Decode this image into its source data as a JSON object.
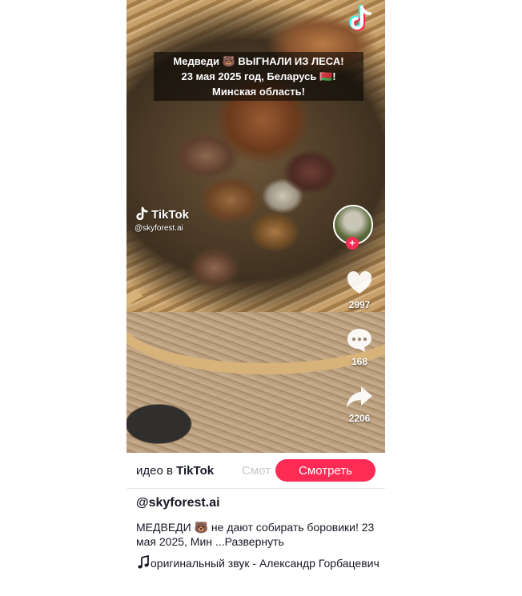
{
  "video": {
    "caption_lines": [
      "Медведи 🐻 ВЫГНАЛИ ИЗ ЛЕСА!",
      "23 мая 2025 год, Беларусь 🇧🇾!",
      "Минская область!"
    ],
    "watermark_brand": "TikTok",
    "watermark_handle": "@skyforest.ai"
  },
  "actions": {
    "likes": "2997",
    "comments": "168",
    "shares": "2206",
    "follow_symbol": "+"
  },
  "bar": {
    "text_prefix": "идео в ",
    "text_brand": "TikTok",
    "ghost_text": "Смот",
    "watch_label": "Смотреть"
  },
  "post": {
    "author": "@skyforest.ai",
    "description": "МЕДВЕДИ 🐻 не дают собирать боровики! 23 мая 2025, Мин ...",
    "more_label": "Развернуть",
    "sound": "оригинальный звук - Александр Горбацевич"
  },
  "colors": {
    "accent": "#fe2c55",
    "text": "#161823"
  }
}
